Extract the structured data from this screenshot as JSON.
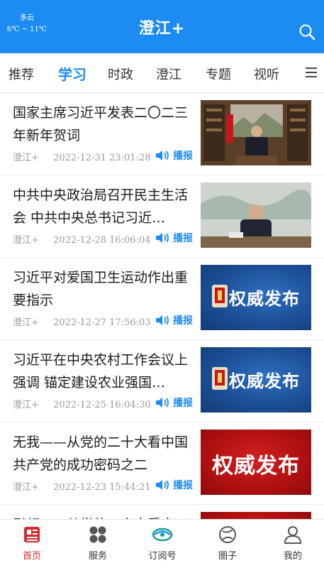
{
  "header": {
    "weather_condition": "多云",
    "weather_temp": "6℃ ~ 11℃",
    "title": "澄江+",
    "search_icon": "search-icon"
  },
  "tabs": [
    {
      "label": "推荐",
      "active": false
    },
    {
      "label": "学习",
      "active": true
    },
    {
      "label": "时政",
      "active": false
    },
    {
      "label": "澄江",
      "active": false
    },
    {
      "label": "专题",
      "active": false
    },
    {
      "label": "视听",
      "active": false
    }
  ],
  "articles": [
    {
      "title": "国家主席习近平发表二〇二三年新年贺词",
      "source": "澄江+",
      "time": "2022-12-31 23:01:28",
      "play_label": "播报"
    },
    {
      "title": "中共中央政治局召开民主生活会 中共中央总书记习近…",
      "source": "澄江+",
      "time": "2022-12-28 16:06:04",
      "play_label": "播报"
    },
    {
      "title": "习近平对爱国卫生运动作出重要指示",
      "source": "澄江+",
      "time": "2022-12-27 17:56:03",
      "play_label": "播报",
      "badge": "权威发布"
    },
    {
      "title": "习近平在中央农村工作会议上强调 锚定建设农业强国…",
      "source": "澄江+",
      "time": "2022-12-25 16:04:30",
      "play_label": "播报",
      "badge": "权威发布"
    },
    {
      "title": "无我——从党的二十大看中国共产党的成功密码之二",
      "source": "澄江+",
      "time": "2022-12-23 15:44:21",
      "play_label": "播报",
      "badge": "权威发布"
    },
    {
      "title": "引领——从党的二十大看中"
    }
  ],
  "bottom_nav": [
    {
      "label": "首页",
      "icon": "home-news-icon",
      "active": true
    },
    {
      "label": "服务",
      "icon": "grid-icon",
      "active": false
    },
    {
      "label": "订阅号",
      "icon": "subscribe-icon",
      "active": false
    },
    {
      "label": "圈子",
      "icon": "circle-icon",
      "active": false
    },
    {
      "label": "我的",
      "icon": "user-icon",
      "active": false
    }
  ],
  "colors": {
    "accent": "#1d8cf2",
    "active_nav": "#d62a2a"
  }
}
